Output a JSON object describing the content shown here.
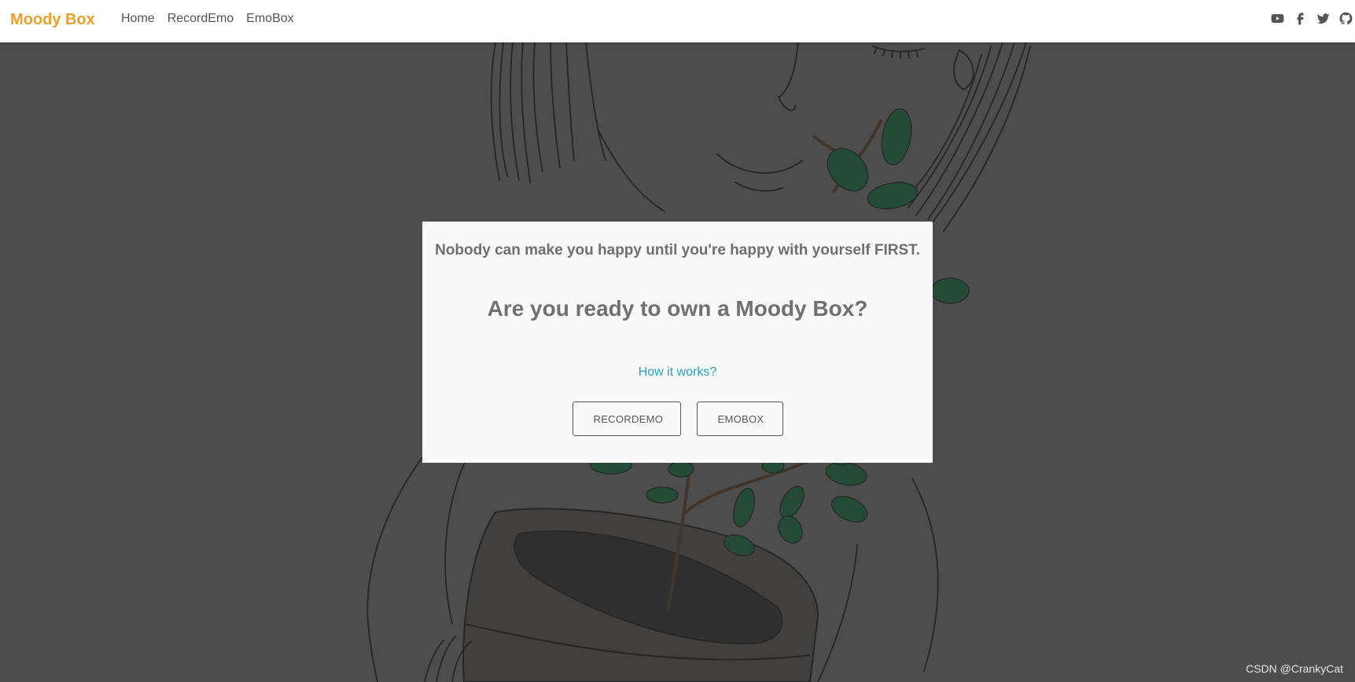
{
  "navbar": {
    "brand": "Moody Box",
    "links": [
      {
        "label": "Home"
      },
      {
        "label": "RecordEmo"
      },
      {
        "label": "EmoBox"
      }
    ],
    "social_icons": [
      "youtube-icon",
      "facebook-icon",
      "twitter-icon",
      "github-icon"
    ]
  },
  "card": {
    "quote": "Nobody can make you happy until you're happy with yourself FIRST.",
    "headline": "Are you ready to own a Moody Box?",
    "how_link": "How it works?",
    "buttons": {
      "record": "RECORDEMO",
      "emobox": "EMOBOX"
    }
  },
  "watermark": "CSDN @CrankyCat",
  "colors": {
    "brand": "#e8a130",
    "link": "#2aa0c0",
    "overlay": "#4d4d4d",
    "card": "#f9f9f9",
    "leaf": "#0f4a2a"
  }
}
